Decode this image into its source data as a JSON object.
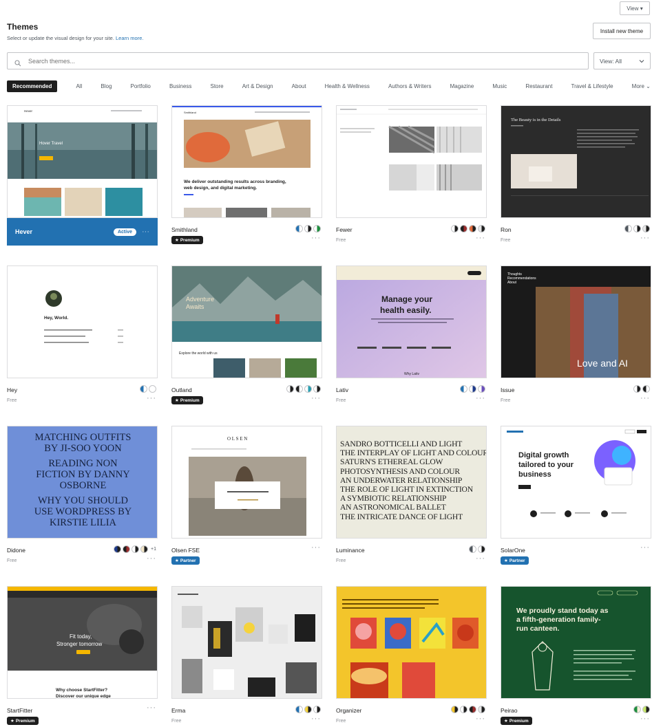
{
  "header": {
    "view_label": "View ▾",
    "title": "Themes",
    "subtitle": "Select or update the visual design for your site.",
    "learn_more": "Learn more.",
    "install_label": "Install new theme"
  },
  "search": {
    "placeholder": "Search themes...",
    "view_filter": "View: All"
  },
  "tabs": [
    "Recommended",
    "All",
    "Blog",
    "Portfolio",
    "Business",
    "Store",
    "Art & Design",
    "About",
    "Health & Wellness",
    "Authors & Writers",
    "Magazine",
    "Music",
    "Restaurant",
    "Travel & Lifestyle",
    "More"
  ],
  "themes": [
    {
      "name": "Hever",
      "status": "Active",
      "active": true
    },
    {
      "name": "Smithland",
      "badge": "Premium"
    },
    {
      "name": "Fewer",
      "price": "Free"
    },
    {
      "name": "Ron",
      "price": "Free"
    },
    {
      "name": "Hey",
      "price": "Free"
    },
    {
      "name": "Outland",
      "badge": "Premium"
    },
    {
      "name": "Lativ",
      "price": "Free"
    },
    {
      "name": "Issue",
      "price": "Free"
    },
    {
      "name": "Didone",
      "price": "Free",
      "more": "+1"
    },
    {
      "name": "Olsen FSE",
      "badge": "Partner"
    },
    {
      "name": "Luminance",
      "price": "Free"
    },
    {
      "name": "SolarOne",
      "badge": "Partner"
    },
    {
      "name": "StartFitter",
      "badge": "Premium"
    },
    {
      "name": "Erma",
      "price": "Free"
    },
    {
      "name": "Organizer",
      "price": "Free"
    },
    {
      "name": "Peirao",
      "badge": "Premium"
    }
  ],
  "previews": {
    "hever": {
      "site": "Hever",
      "hero": "Hover Travel"
    },
    "smithland": {
      "site": "Smithland",
      "headline1": "We deliver outstanding results across branding,",
      "headline2": "web design, and digital marketing."
    },
    "ron": {
      "title": "The Beauty is in the Details"
    },
    "hey": {
      "title": "Hey, World."
    },
    "outland": {
      "hero1": "Adventure",
      "hero2": "Awaits",
      "caption": "Explore the world with us"
    },
    "lativ": {
      "line1": "Manage your",
      "line2": "health easily.",
      "footer": "Why Lativ"
    },
    "issue": {
      "nav1": "Thoughts",
      "nav2": "Recommendations",
      "nav3": "About",
      "caption": "Love and AI"
    },
    "didone": {
      "lines": [
        "MATCHING OUTFITS",
        "BY JI-SOO YOON",
        "READING NON",
        "FICTION BY DANNY",
        "OSBORNE",
        "WHY YOU SHOULD",
        "USE WORDPRESS BY",
        "KIRSTIE LILIA"
      ]
    },
    "olsen": {
      "logo": "O L S E N"
    },
    "luminance": {
      "lines": [
        "SANDRO BOTTICELLI AND LIGHT",
        "THE INTERPLAY OF LIGHT AND COLOUR",
        "SATURN'S ETHEREAL GLOW",
        "PHOTOSYNTHESIS AND COLOUR",
        "AN UNDERWATER RELATIONSHIP",
        "THE ROLE OF LIGHT IN EXTINCTION",
        "A SYMBIOTIC RELATIONSHIP",
        "AN ASTRONOMICAL BALLET",
        "THE INTRICATE DANCE OF LIGHT"
      ]
    },
    "solarone": {
      "line1": "Digital growth",
      "line2": "tailored to your",
      "line3": "business"
    },
    "startfitter": {
      "hero1": "Fit today,",
      "hero2": "Stronger tomorrow",
      "q1": "Why choose StartFitter?",
      "q2": "Discover our unique edge"
    },
    "peirao": {
      "line1": "We proudly stand today as",
      "line2": "a fifth-generation family-",
      "line3": "run canteen."
    }
  },
  "colors": {
    "accent": "#2271b1",
    "dark": "#1e1e1e",
    "muted": "#8c8f94"
  }
}
